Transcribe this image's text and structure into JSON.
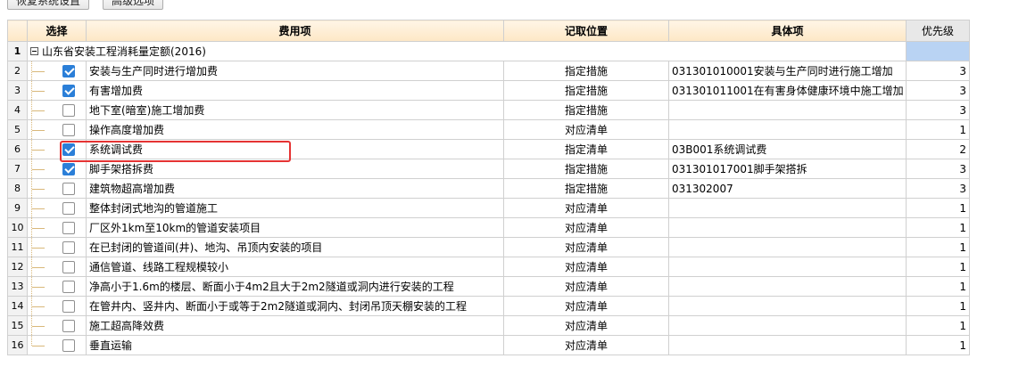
{
  "toolbar": {
    "restore_label": "恢复系统设置",
    "advanced_label": "高级选项"
  },
  "columns": {
    "select": "选择",
    "fee": "费用项",
    "position": "记取位置",
    "item": "具体项",
    "priority": "优先级"
  },
  "group": {
    "row": "1",
    "label": "山东省安装工程消耗量定额(2016)"
  },
  "rows": [
    {
      "num": "2",
      "checked": true,
      "fee": "安装与生产同时进行增加费",
      "position": "指定措施",
      "item": "031301010001安装与生产同时进行施工增加",
      "priority": "3"
    },
    {
      "num": "3",
      "checked": true,
      "fee": "有害增加费",
      "position": "指定措施",
      "item": "031301011001在有害身体健康环境中施工增加",
      "priority": "3"
    },
    {
      "num": "4",
      "checked": false,
      "fee": "地下室(暗室)施工增加费",
      "position": "指定措施",
      "item": "",
      "priority": "3"
    },
    {
      "num": "5",
      "checked": false,
      "fee": "操作高度增加费",
      "position": "对应清单",
      "item": "",
      "priority": "1"
    },
    {
      "num": "6",
      "checked": true,
      "fee": "系统调试费",
      "position": "指定清单",
      "item": "03B001系统调试费",
      "priority": "2"
    },
    {
      "num": "7",
      "checked": true,
      "fee": "脚手架搭拆费",
      "position": "指定措施",
      "item": "031301017001脚手架搭拆",
      "priority": "3"
    },
    {
      "num": "8",
      "checked": false,
      "fee": "建筑物超高增加费",
      "position": "指定措施",
      "item": "031302007",
      "priority": "3"
    },
    {
      "num": "9",
      "checked": false,
      "fee": "整体封闭式地沟的管道施工",
      "position": "对应清单",
      "item": "",
      "priority": "1"
    },
    {
      "num": "10",
      "checked": false,
      "fee": "厂区外1km至10km的管道安装项目",
      "position": "对应清单",
      "item": "",
      "priority": "1"
    },
    {
      "num": "11",
      "checked": false,
      "fee": "在已封闭的管道间(井)、地沟、吊顶内安装的项目",
      "position": "对应清单",
      "item": "",
      "priority": "1"
    },
    {
      "num": "12",
      "checked": false,
      "fee": "通信管道、线路工程规模较小",
      "position": "对应清单",
      "item": "",
      "priority": "1"
    },
    {
      "num": "13",
      "checked": false,
      "fee": "净高小于1.6m的楼层、断面小于4m2且大于2m2隧道或洞内进行安装的工程",
      "position": "对应清单",
      "item": "",
      "priority": "1"
    },
    {
      "num": "14",
      "checked": false,
      "fee": "在管井内、竖井内、断面小于或等于2m2隧道或洞内、封闭吊顶天棚安装的工程",
      "position": "对应清单",
      "item": "",
      "priority": "1"
    },
    {
      "num": "15",
      "checked": false,
      "fee": "施工超高降效费",
      "position": "对应清单",
      "item": "",
      "priority": "1"
    },
    {
      "num": "16",
      "checked": false,
      "fee": "垂直运输",
      "position": "对应清单",
      "item": "",
      "priority": "1"
    }
  ],
  "colors": {
    "checkbox_checked": "#2b7fd8",
    "highlight_border": "#e53333",
    "selection_border": "#2f6fcf"
  }
}
